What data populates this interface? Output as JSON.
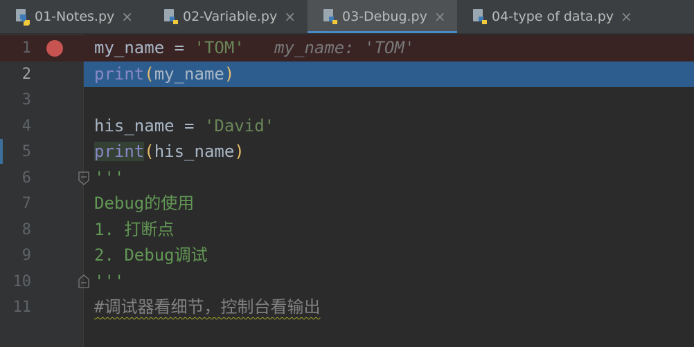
{
  "tabs": [
    {
      "label": "01-Notes.py",
      "active": false
    },
    {
      "label": "02-Variable.py",
      "active": false
    },
    {
      "label": "03-Debug.py",
      "active": true
    },
    {
      "label": "04-type of data.py",
      "active": false
    }
  ],
  "close_glyph": "×",
  "lines": {
    "n1": "1",
    "n2": "2",
    "n3": "3",
    "n4": "4",
    "n5": "5",
    "n6": "6",
    "n7": "7",
    "n8": "8",
    "n9": "9",
    "n10": "10",
    "n11": "11"
  },
  "code": {
    "l1_var": "my_name = ",
    "l1_str": "'TOM'",
    "l1_hint": "my_name: 'TOM'",
    "l2_fn": "print",
    "l2_open": "(",
    "l2_arg": "my_name",
    "l2_close": ")",
    "l4_var": "his_name = ",
    "l4_str": "'David'",
    "l5_fn": "print",
    "l5_open": "(",
    "l5_arg": "his_name",
    "l5_close": ")",
    "l6_doc": "'''",
    "l7_doc": "Debug的使用",
    "l8_doc": "1. 打断点",
    "l9_doc": "2. Debug调试",
    "l10_doc": "'''",
    "l11_cmt": "#调试器看细节，控制台看输出"
  },
  "colors": {
    "breakpoint": "#c75450",
    "current_line": "#2d5d8e",
    "active_tab_underline": "#4a88c7"
  }
}
